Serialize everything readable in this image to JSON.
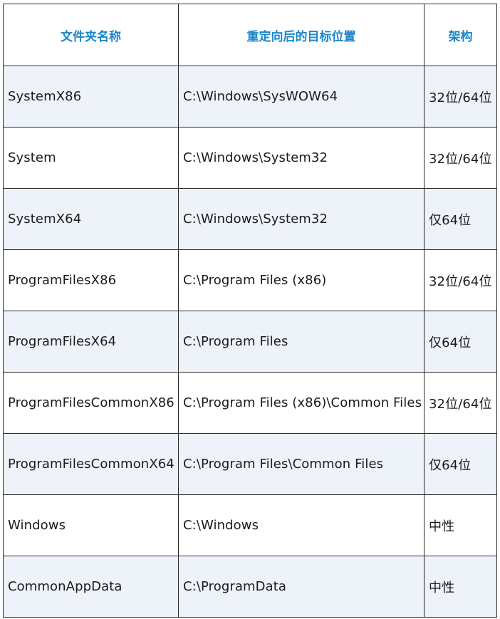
{
  "colors": {
    "header_text": "#1a86c9",
    "row_alt_background": "#eef3fa",
    "border": "#2a2a2a"
  },
  "table": {
    "headers": [
      "文件夹名称",
      "重定向后的目标位置",
      "架构"
    ],
    "rows": [
      [
        "SystemX86",
        "C:\\Windows\\SysWOW64",
        "32位/64位"
      ],
      [
        "System",
        "C:\\Windows\\System32",
        "32位/64位"
      ],
      [
        "SystemX64",
        "C:\\Windows\\System32",
        "仅64位"
      ],
      [
        "ProgramFilesX86",
        "C:\\Program Files (x86)",
        "32位/64位"
      ],
      [
        "ProgramFilesX64",
        "C:\\Program Files",
        "仅64位"
      ],
      [
        "ProgramFilesCommonX86",
        "C:\\Program Files (x86)\\Common Files",
        "32位/64位"
      ],
      [
        "ProgramFilesCommonX64",
        "C:\\Program Files\\Common Files",
        "仅64位"
      ],
      [
        "Windows",
        "C:\\Windows",
        "中性"
      ],
      [
        "CommonAppData",
        "C:\\ProgramData",
        "中性"
      ]
    ]
  }
}
